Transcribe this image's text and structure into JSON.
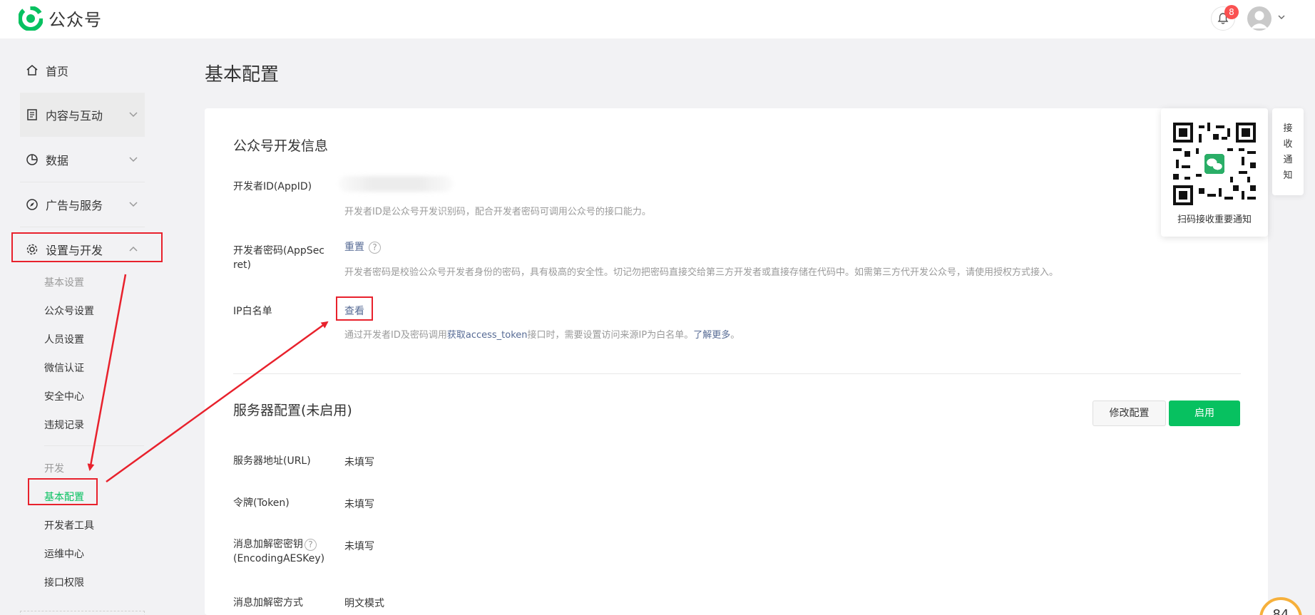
{
  "header": {
    "logo_text": "公众号",
    "notification_count": "8"
  },
  "sidebar": {
    "home": "首页",
    "content": "内容与互动",
    "data": "数据",
    "ads": "广告与服务",
    "settings": "设置与开发",
    "settings_items": [
      "基本设置",
      "公众号设置",
      "人员设置",
      "微信认证",
      "安全中心",
      "违规记录"
    ],
    "dev_group": "开发",
    "dev_items": [
      "基本配置",
      "开发者工具",
      "运维中心",
      "接口权限"
    ]
  },
  "main": {
    "title": "基本配置",
    "dev_info": {
      "title": "公众号开发信息",
      "appid_label": "开发者ID(AppID)",
      "appid_hint": "开发者ID是公众号开发识别码，配合开发者密码可调用公众号的接口能力。",
      "secret_label_1": "开发者密码(AppSec",
      "secret_label_2": "ret)",
      "secret_action": "重置",
      "secret_hint": "开发者密码是校验公众号开发者身份的密码，具有极高的安全性。切记勿把密码直接交给第三方开发者或直接存储在代码中。如需第三方代开发公众号，请使用授权方式接入。",
      "ip_label": "IP白名单",
      "ip_action": "查看",
      "ip_hint_pre": "通过开发者ID及密码调用",
      "ip_hint_link": "获取access_token",
      "ip_hint_mid": "接口时，需要设置访问来源IP为白名单。",
      "ip_hint_more": "了解更多",
      "ip_hint_end": "。"
    },
    "server": {
      "title": "服务器配置(未启用)",
      "edit_button": "修改配置",
      "enable_button": "启用",
      "url_label": "服务器地址(URL)",
      "url_value": "未填写",
      "token_label": "令牌(Token)",
      "token_value": "未填写",
      "aes_label_1": "消息加解密密钥",
      "aes_label_2": "(EncodingAESKey)",
      "aes_value": "未填写",
      "mode_label": "消息加解密方式",
      "mode_value": "明文模式"
    }
  },
  "qr_panel": {
    "caption": "扫码接收重要通知"
  },
  "side_tab": {
    "chars": [
      "接",
      "收",
      "通",
      "知"
    ]
  },
  "score_widget": {
    "value": "84"
  },
  "colors": {
    "brand_green": "#07c160",
    "link": "#576b95",
    "annotation_red": "#e8212c"
  }
}
